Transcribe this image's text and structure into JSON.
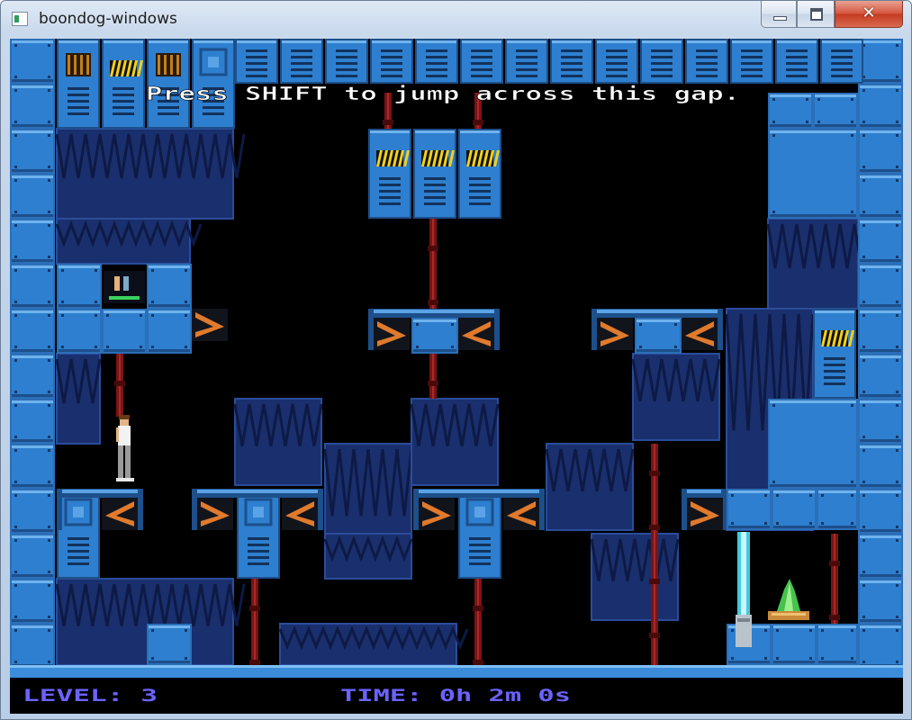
{
  "window": {
    "title": "boondog-windows",
    "close_glyph": "✕"
  },
  "game": {
    "hint_message": "Press SHIFT to jump across this gap.",
    "hud": {
      "level_label": "LEVEL: 3",
      "time_label": "TIME: 0h 2m 0s"
    },
    "colors": {
      "wall_blue": "#2e7fcf",
      "dark_panel": "#1a2f6d",
      "background": "#000000",
      "hud_text": "#6b63ff",
      "laser": "#4de0f0",
      "hazard_yellow": "#f2d21b",
      "bracket_orange": "#e07a2c",
      "pipe_red": "#7a1414"
    },
    "icons": [
      "player-character",
      "green-crystal-pickup",
      "laser-emitter",
      "door-switch"
    ]
  }
}
